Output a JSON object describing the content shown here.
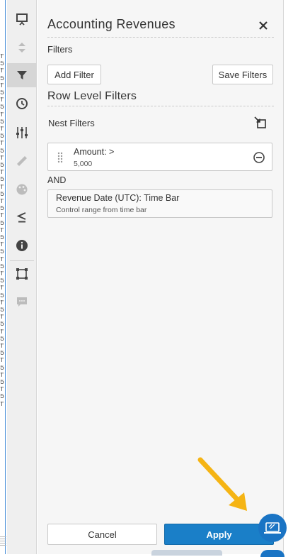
{
  "background_fragments": [
    "f",
    "5",
    "f",
    "5",
    "f",
    "5",
    "f",
    "5",
    "f",
    "5",
    "f",
    "5",
    "f",
    "5",
    "f",
    "5",
    "f",
    "5",
    "f",
    "5",
    "f",
    "5",
    "f",
    "5",
    "f",
    "5",
    "f",
    "5",
    "f",
    "5",
    "f",
    "5",
    "f",
    "5",
    "f",
    "5",
    "f",
    "5",
    "f",
    "5",
    "f",
    "5",
    "f",
    "5",
    "f",
    "5",
    "f",
    "5",
    "f"
  ],
  "rail": {
    "items": [
      {
        "name": "presentation-icon",
        "active": false,
        "disabled": false
      },
      {
        "name": "sort-icon",
        "active": false,
        "disabled": true
      },
      {
        "name": "filter-icon",
        "active": true,
        "disabled": false
      },
      {
        "name": "clock-icon",
        "active": false,
        "disabled": false
      },
      {
        "name": "sliders-icon",
        "active": false,
        "disabled": false
      },
      {
        "name": "ruler-icon",
        "active": false,
        "disabled": true
      },
      {
        "name": "palette-icon",
        "active": false,
        "disabled": true
      },
      {
        "name": "less-equal-icon",
        "active": false,
        "disabled": false
      },
      {
        "name": "info-icon",
        "active": false,
        "disabled": false
      },
      {
        "name": "selection-icon",
        "active": false,
        "disabled": false
      },
      {
        "name": "comment-icon",
        "active": false,
        "disabled": true
      }
    ],
    "color_active": "#444444",
    "color_disabled": "#bcbcbc"
  },
  "panel": {
    "title": "Accounting Revenues",
    "filters_label": "Filters",
    "add_filter": "Add Filter",
    "save_filters": "Save Filters",
    "row_level_filters": "Row Level Filters",
    "nest_filters": "Nest Filters",
    "filter1": {
      "title": "Amount: >",
      "value": "5,000"
    },
    "and_label": "AND",
    "filter2": {
      "title": "Revenue Date (UTC): Time Bar",
      "subtitle": "Control range from time bar"
    },
    "cancel": "Cancel",
    "apply": "Apply"
  },
  "colors": {
    "accent": "#1a7fc8",
    "arrow": "#f5b414",
    "panel_bg": "#f6f6f6"
  }
}
